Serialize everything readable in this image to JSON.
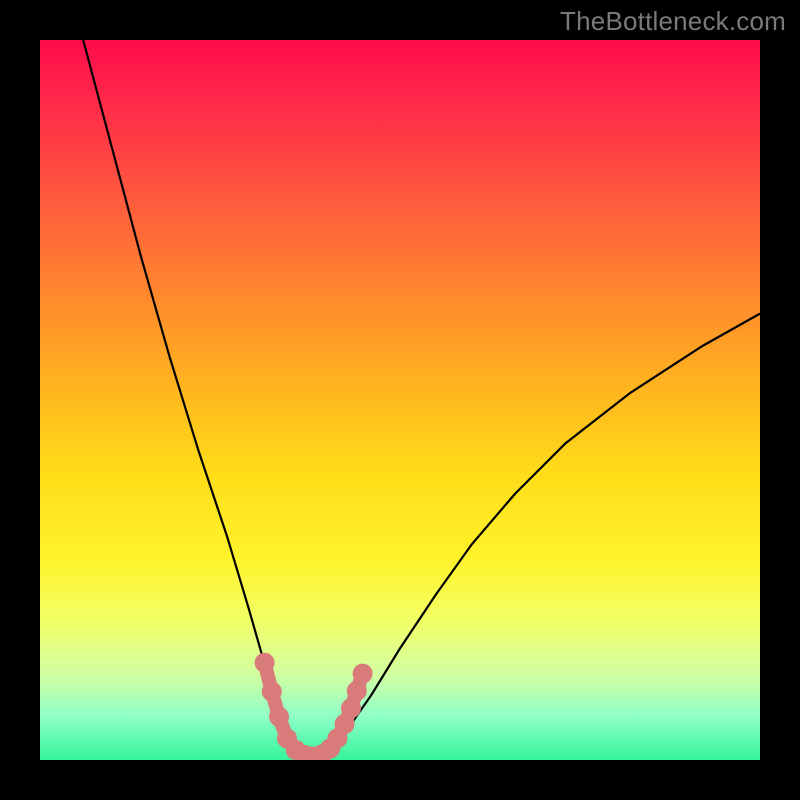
{
  "watermark": "TheBottleneck.com",
  "chart_data": {
    "type": "line",
    "title": "",
    "xlabel": "",
    "ylabel": "",
    "xlim": [
      0,
      100
    ],
    "ylim": [
      0,
      100
    ],
    "series": [
      {
        "name": "bottleneck-curve",
        "x": [
          6,
          10,
          14,
          18,
          22,
          26,
          29,
          31,
          33,
          34.5,
          36,
          38,
          40,
          42.5,
          46,
          50,
          55,
          60,
          66,
          73,
          82,
          92,
          100
        ],
        "values": [
          100,
          85,
          70,
          56,
          43,
          31,
          21,
          14,
          8,
          3.5,
          1,
          0.5,
          1.5,
          4,
          9,
          15.5,
          23,
          30,
          37,
          44,
          51,
          57.5,
          62
        ]
      }
    ],
    "highlight": {
      "name": "valley-highlight",
      "color": "#d97b7b",
      "points": [
        {
          "x": 31.2,
          "y": 13.5
        },
        {
          "x": 32.2,
          "y": 9.5
        },
        {
          "x": 33.2,
          "y": 6.0
        },
        {
          "x": 34.3,
          "y": 3.0
        },
        {
          "x": 35.5,
          "y": 1.4
        },
        {
          "x": 36.8,
          "y": 0.7
        },
        {
          "x": 38.0,
          "y": 0.5
        },
        {
          "x": 39.2,
          "y": 0.8
        },
        {
          "x": 40.3,
          "y": 1.6
        },
        {
          "x": 41.3,
          "y": 3.0
        },
        {
          "x": 42.3,
          "y": 5.0
        },
        {
          "x": 43.2,
          "y": 7.2
        },
        {
          "x": 44.0,
          "y": 9.6
        },
        {
          "x": 44.8,
          "y": 12.0
        }
      ]
    }
  }
}
